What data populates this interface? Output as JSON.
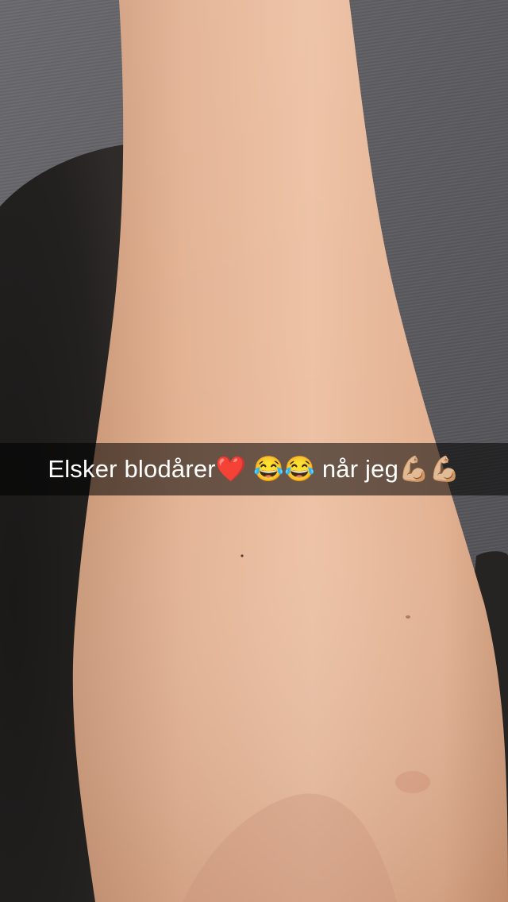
{
  "snap": {
    "caption": "Elsker blodårer❤️ 😂😂 når jeg💪🏼💪🏼"
  },
  "colors": {
    "caption_bar": "#000000",
    "caption_text": "#ffffff",
    "skin": "#e8b89a",
    "fabric": "#5f5e62",
    "shadow": "#1e1c1b"
  }
}
